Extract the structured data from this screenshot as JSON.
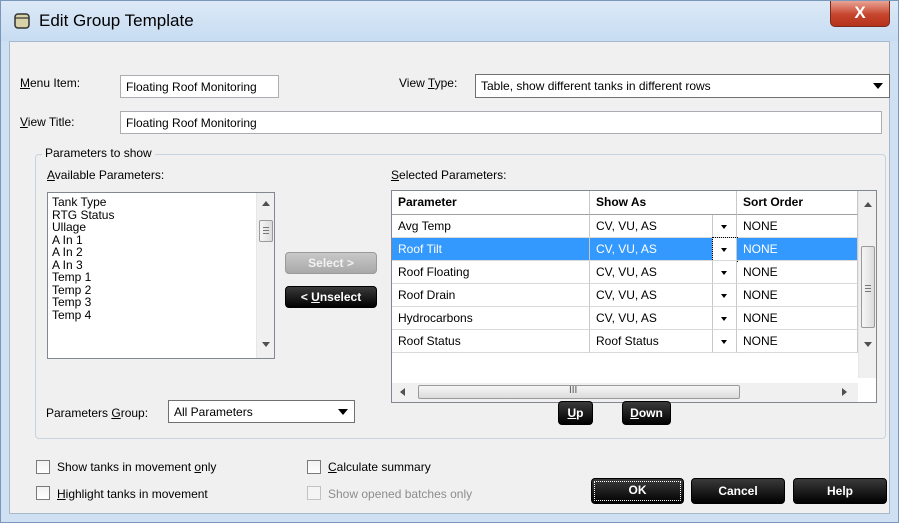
{
  "window": {
    "title": "Edit Group Template",
    "close_label": "X"
  },
  "menu_item": {
    "label_prefix": "",
    "label_u": "M",
    "label_rest": "enu Item:",
    "value": "Floating Roof Monitoring"
  },
  "view_type": {
    "label_pre": "View ",
    "label_u": "T",
    "label_rest": "ype:",
    "value": "Table, show different tanks in different rows"
  },
  "view_title": {
    "label_u": "V",
    "label_rest": "iew Title:",
    "value": "Floating Roof Monitoring"
  },
  "params_group_box": {
    "legend": "Parameters to show"
  },
  "available": {
    "label_u": "A",
    "label_rest": "vailable Parameters:",
    "items": [
      "Tank Type",
      "RTG Status",
      "Ullage",
      "A In 1",
      "A In 2",
      "A In 3",
      "Temp 1",
      "Temp 2",
      "Temp 3",
      "Temp 4"
    ]
  },
  "buttons": {
    "select": "Select >",
    "unselect_pre": "< ",
    "unselect_u": "U",
    "unselect_rest": "nselect",
    "up_u": "U",
    "up_rest": "p",
    "down_u": "D",
    "down_rest": "own",
    "ok": "OK",
    "cancel": "Cancel",
    "help": "Help"
  },
  "selected": {
    "label_u": "S",
    "label_rest": "elected Parameters:",
    "columns": [
      "Parameter",
      "Show As",
      "Sort Order"
    ],
    "rows": [
      {
        "parameter": "Avg Temp",
        "show_as": "CV, VU, AS",
        "sort": "NONE"
      },
      {
        "parameter": "Roof Tilt",
        "show_as": "CV, VU, AS",
        "sort": "NONE"
      },
      {
        "parameter": "Roof Floating",
        "show_as": "CV, VU, AS",
        "sort": "NONE"
      },
      {
        "parameter": "Roof Drain",
        "show_as": "CV, VU, AS",
        "sort": "NONE"
      },
      {
        "parameter": "Hydrocarbons",
        "show_as": "CV, VU, AS",
        "sort": "NONE"
      },
      {
        "parameter": "Roof Status",
        "show_as": "Roof Status",
        "sort": "NONE"
      }
    ],
    "selected_row": 1,
    "hscroll_grip": "III"
  },
  "parameters_group": {
    "label_pre": "Parameters ",
    "label_u": "G",
    "label_rest": "roup:",
    "value": "All Parameters"
  },
  "checkboxes": {
    "show_moving_pre": "Show tanks in movement ",
    "show_moving_u": "o",
    "show_moving_rest": "nly",
    "calc_u": "C",
    "calc_rest": "alculate summary",
    "highlight_u": "H",
    "highlight_rest": "ighlight tanks in movement",
    "opened_batches": "Show opened batches only"
  },
  "colors": {
    "selection": "#3399ff",
    "title_bg": "#c7dcf2",
    "close": "#c6442c"
  }
}
